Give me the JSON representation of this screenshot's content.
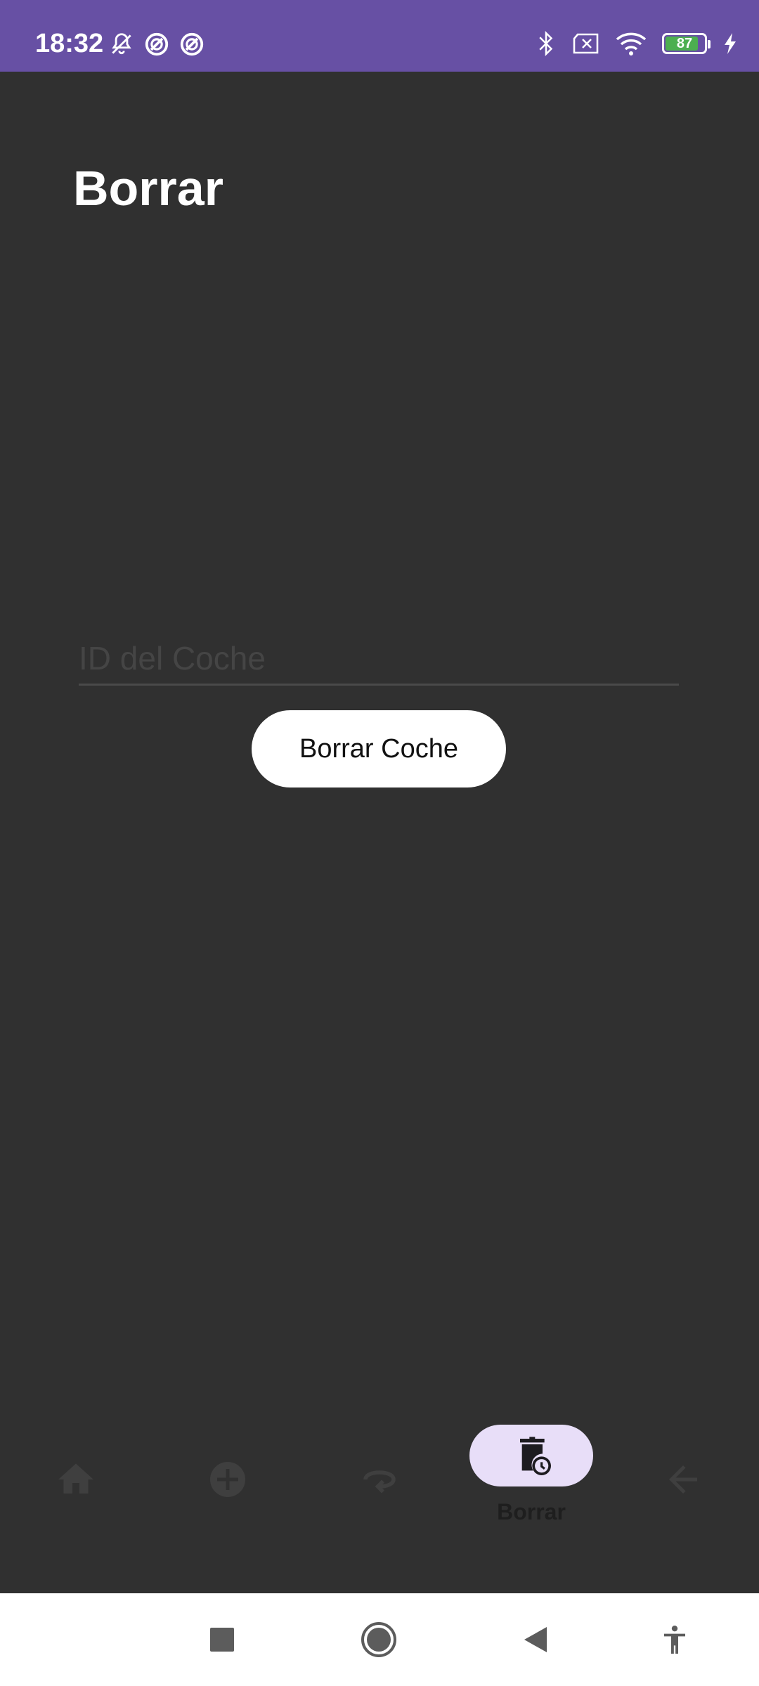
{
  "status_bar": {
    "time": "18:32",
    "battery_level": "87",
    "battery_fraction": 0.87,
    "bg_color": "#6750A4",
    "left_icons": [
      "bell-off-icon",
      "blocked-circle-icon",
      "blocked-circle-icon"
    ],
    "right_icons": [
      "bluetooth-icon",
      "sim-x-icon",
      "wifi-icon",
      "battery-icon",
      "charging-bolt-icon"
    ]
  },
  "page": {
    "title": "Borrar"
  },
  "form": {
    "id_placeholder": "ID del Coche",
    "id_value": "",
    "delete_button_label": "Borrar Coche"
  },
  "bottom_nav": {
    "items": [
      {
        "icon": "home-icon",
        "label": "",
        "active": false
      },
      {
        "icon": "add-circle-icon",
        "label": "",
        "active": false
      },
      {
        "icon": "swap-loop-icon",
        "label": "",
        "active": false
      },
      {
        "icon": "delete-clock-icon",
        "label": "Borrar",
        "active": true
      },
      {
        "icon": "back-arrow-icon",
        "label": "",
        "active": false
      }
    ],
    "active_pill_color": "#E8DEF8",
    "inactive_icon_color": "#3f3f3f"
  },
  "system_nav": {
    "buttons": [
      "recents-square-icon",
      "home-circle-icon",
      "back-triangle-icon",
      "accessibility-icon"
    ]
  }
}
